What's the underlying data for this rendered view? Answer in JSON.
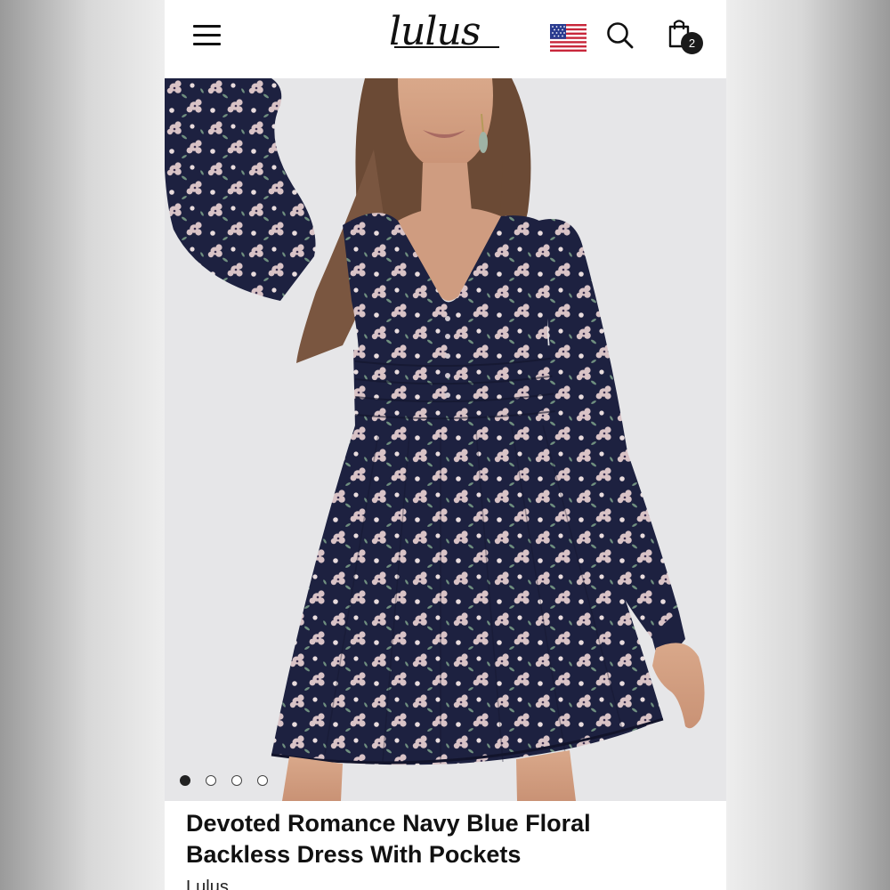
{
  "header": {
    "logo_text": "lulus",
    "menu_icon": "hamburger-menu-icon",
    "flag_icon": "us-flag-icon",
    "search_icon": "search-icon",
    "bag_icon": "shopping-bag-icon",
    "bag_count": "2"
  },
  "gallery": {
    "image_icon": "product-photo-floral-dress",
    "slide_count": 4,
    "active_slide": 1
  },
  "product": {
    "title_line1": "Devoted Romance Navy Blue Floral",
    "title_line2": "Backless Dress With Pockets",
    "brand": "Lulus"
  },
  "colors": {
    "dress_navy": "#1d2140",
    "flower_pink": "#d9c3c6",
    "background": "#e7e7e9"
  }
}
